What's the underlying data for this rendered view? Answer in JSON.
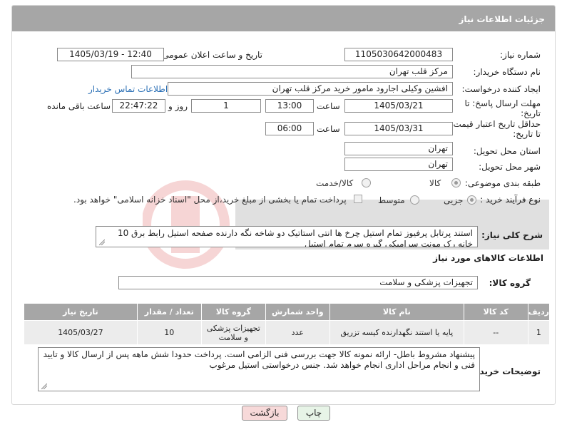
{
  "header": {
    "title": "جزئیات اطلاعات نیاز"
  },
  "fields": {
    "need_number_label": "شماره نیاز:",
    "need_number": "1105030642000483",
    "announce_label": "تاریخ و ساعت اعلان عمومی:",
    "announce_value": "1405/03/19 - 12:40",
    "buyer_org_label": "نام دستگاه خریدار:",
    "buyer_org": "مرکز قلب تهران",
    "creator_label": "ایجاد کننده درخواست:",
    "creator": "افشین وکیلی اجارود مامور خرید مرکز قلب تهران",
    "contact_link": "اطلاعات تماس خریدار",
    "reply_deadline_label_1": "مهلت ارسال پاسخ: تا",
    "reply_deadline_label_2": "تاریخ:",
    "reply_date": "1405/03/21",
    "time_label": "ساعت",
    "reply_time": "13:00",
    "days_value": "1",
    "days_label": "روز و",
    "remaining_time": "22:47:22",
    "remaining_label": "ساعت باقی مانده",
    "validity_label_1": "حداقل تاریخ اعتبار قیمت:",
    "validity_label_2": "تا تاریخ:",
    "validity_date": "1405/03/31",
    "validity_time": "06:00",
    "province_label": "استان محل تحویل:",
    "province": "تهران",
    "city_label": "شهر محل تحویل:",
    "city": "تهران",
    "category_label": "طبقه بندی موضوعی:",
    "category_options": [
      "کالا",
      "کالا/خدمت"
    ],
    "category_selected": "کالا",
    "process_label": "نوع فرآیند خرید :",
    "process_options": [
      "جزیی",
      "متوسط"
    ],
    "process_selected": "جزیی",
    "payment_note": "پرداخت تمام یا بخشی از مبلغ خرید،از محل \"اسناد خزانه اسلامی\" خواهد بود.",
    "general_desc_label": "شرح کلی نیاز:",
    "general_desc": "استند پرتابل پرفیوز تمام استیل  چرخ ها انتی استاتیک  دو شاخه نگه دارنده  صفحه استیل رابط برق 10 خانه رک مونت سرامیکی گیره سرم تمام استیل",
    "goods_info_title": "اطلاعات کالاهای مورد نیاز",
    "goods_group_label": "گروه کالا:",
    "goods_group": "تجهیزات پزشکی و سلامت"
  },
  "table": {
    "headers": [
      "ردیف",
      "کد کالا",
      "نام کالا",
      "واحد شمارش",
      "گروه کالا",
      "تعداد / مقدار",
      "تاریخ نیاز"
    ],
    "rows": [
      [
        "1",
        "--",
        "پایه یا استند نگهدارنده کیسه تزریق",
        "عدد",
        "تجهیزات پزشکی و سلامت",
        "10",
        "1405/03/27"
      ]
    ]
  },
  "buyer_notes": {
    "label": "توضیحات خریدار:",
    "text": "پیشنهاد مشروط باطل- ارائه نمونه کالا جهت بررسی فنی الزامی است. پرداخت حدودا شش ماهه پس از ارسال کالا و تایید فنی و انجام مراحل اداری انجام خواهد شد. جنس درخواستی استیل مرغوب"
  },
  "buttons": {
    "print": "چاپ",
    "back": "بازگشت"
  }
}
